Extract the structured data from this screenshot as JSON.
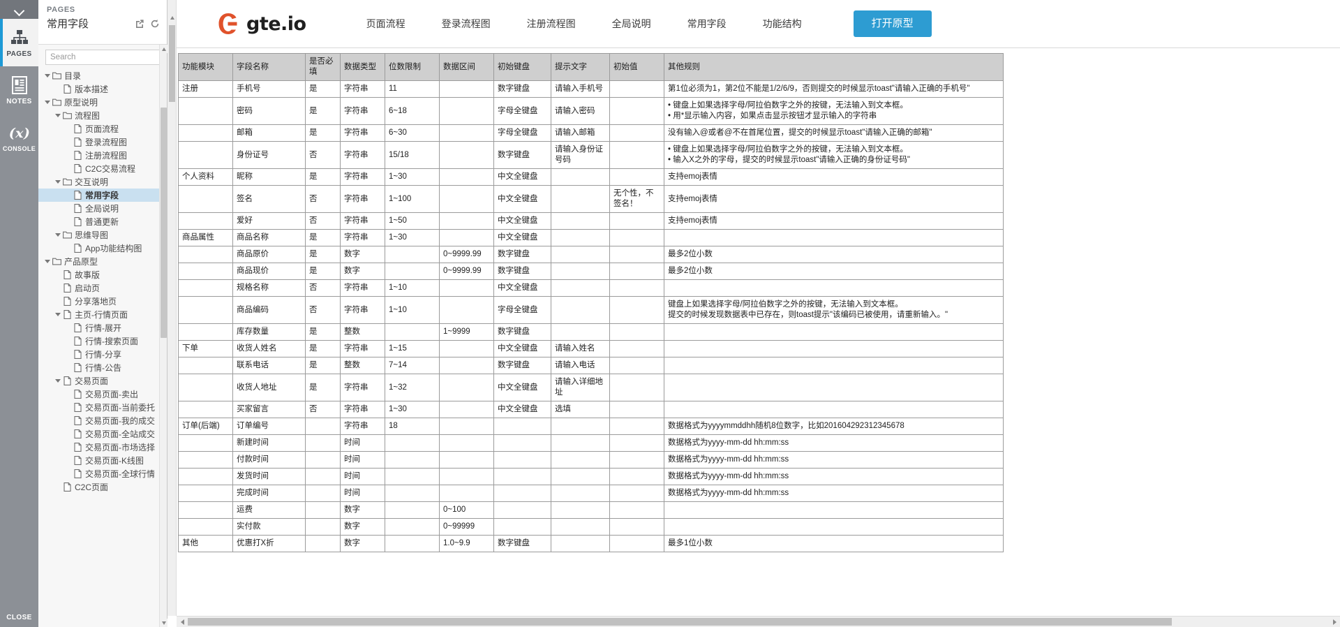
{
  "rail": {
    "collapse_icon": "chevron-down-icon",
    "buttons": [
      {
        "id": "pages",
        "label": "PAGES",
        "icon": "sitemap-icon",
        "active": true
      },
      {
        "id": "notes",
        "label": "NOTES",
        "icon": "notes-icon",
        "active": false
      },
      {
        "id": "console",
        "label": "CONSOLE",
        "icon": "variable-x-icon",
        "active": false
      }
    ],
    "close_label": "CLOSE"
  },
  "pages_panel": {
    "kicker": "PAGES",
    "title": "常用字段",
    "header_icons": [
      "open-in-new-icon",
      "refresh-icon"
    ],
    "search": {
      "placeholder": "Search",
      "value": ""
    },
    "tree": [
      {
        "label": "目录",
        "type": "folder",
        "depth": 0,
        "expanded": true,
        "selected": false
      },
      {
        "label": "版本描述",
        "type": "page",
        "depth": 1,
        "expanded": null,
        "selected": false
      },
      {
        "label": "原型说明",
        "type": "folder",
        "depth": 0,
        "expanded": true,
        "selected": false
      },
      {
        "label": "流程图",
        "type": "folder",
        "depth": 1,
        "expanded": true,
        "selected": false
      },
      {
        "label": "页面流程",
        "type": "page",
        "depth": 2,
        "expanded": null,
        "selected": false
      },
      {
        "label": "登录流程图",
        "type": "page",
        "depth": 2,
        "expanded": null,
        "selected": false
      },
      {
        "label": "注册流程图",
        "type": "page",
        "depth": 2,
        "expanded": null,
        "selected": false
      },
      {
        "label": "C2C交易流程",
        "type": "page",
        "depth": 2,
        "expanded": null,
        "selected": false
      },
      {
        "label": "交互说明",
        "type": "folder",
        "depth": 1,
        "expanded": true,
        "selected": false
      },
      {
        "label": "常用字段",
        "type": "page",
        "depth": 2,
        "expanded": null,
        "selected": true
      },
      {
        "label": "全局说明",
        "type": "page",
        "depth": 2,
        "expanded": null,
        "selected": false
      },
      {
        "label": "普通更新",
        "type": "page",
        "depth": 2,
        "expanded": null,
        "selected": false
      },
      {
        "label": "思维导图",
        "type": "folder",
        "depth": 1,
        "expanded": true,
        "selected": false
      },
      {
        "label": "App功能结构图",
        "type": "page",
        "depth": 2,
        "expanded": null,
        "selected": false
      },
      {
        "label": "产品原型",
        "type": "folder",
        "depth": 0,
        "expanded": true,
        "selected": false
      },
      {
        "label": "故事版",
        "type": "page",
        "depth": 1,
        "expanded": null,
        "selected": false
      },
      {
        "label": "启动页",
        "type": "page",
        "depth": 1,
        "expanded": null,
        "selected": false
      },
      {
        "label": "分享落地页",
        "type": "page",
        "depth": 1,
        "expanded": null,
        "selected": false
      },
      {
        "label": "主页-行情页面",
        "type": "page",
        "depth": 1,
        "expanded": true,
        "selected": false
      },
      {
        "label": "行情-展开",
        "type": "page",
        "depth": 2,
        "expanded": null,
        "selected": false
      },
      {
        "label": "行情-搜索页面",
        "type": "page",
        "depth": 2,
        "expanded": null,
        "selected": false
      },
      {
        "label": "行情-分享",
        "type": "page",
        "depth": 2,
        "expanded": null,
        "selected": false
      },
      {
        "label": "行情-公告",
        "type": "page",
        "depth": 2,
        "expanded": null,
        "selected": false
      },
      {
        "label": "交易页面",
        "type": "page",
        "depth": 1,
        "expanded": true,
        "selected": false
      },
      {
        "label": "交易页面-卖出",
        "type": "page",
        "depth": 2,
        "expanded": null,
        "selected": false
      },
      {
        "label": "交易页面-当前委托",
        "type": "page",
        "depth": 2,
        "expanded": null,
        "selected": false
      },
      {
        "label": "交易页面-我的成交",
        "type": "page",
        "depth": 2,
        "expanded": null,
        "selected": false
      },
      {
        "label": "交易页面-全站成交",
        "type": "page",
        "depth": 2,
        "expanded": null,
        "selected": false
      },
      {
        "label": "交易页面-市场选择",
        "type": "page",
        "depth": 2,
        "expanded": null,
        "selected": false
      },
      {
        "label": "交易页面-K线图",
        "type": "page",
        "depth": 2,
        "expanded": null,
        "selected": false
      },
      {
        "label": "交易页面-全球行情",
        "type": "page",
        "depth": 2,
        "expanded": null,
        "selected": false
      },
      {
        "label": "C2C页面",
        "type": "page",
        "depth": 1,
        "expanded": null,
        "selected": false
      }
    ]
  },
  "site_header": {
    "brand": "gte.io",
    "brand_icon": "gte-logo-icon",
    "nav": [
      {
        "label": "页面流程"
      },
      {
        "label": "登录流程图"
      },
      {
        "label": "注册流程图"
      },
      {
        "label": "全局说明"
      },
      {
        "label": "常用字段"
      },
      {
        "label": "功能结构"
      }
    ],
    "cta_label": "打开原型",
    "cta_color": "#2d9cd2"
  },
  "spec_table": {
    "columns": [
      "功能模块",
      "字段名称",
      "是否必填",
      "数据类型",
      "位数限制",
      "数据区间",
      "初始键盘",
      "提示文字",
      "初始值",
      "其他规则"
    ],
    "rows": [
      {
        "功能模块": "注册",
        "字段名称": "手机号",
        "是否必填": "是",
        "数据类型": "字符串",
        "位数限制": "11",
        "数据区间": "",
        "初始键盘": "数字键盘",
        "提示文字": "请输入手机号",
        "初始值": "",
        "其他规则": [
          "第1位必须为1，第2位不能是1/2/6/9，否则提交的时候显示toast\"请输入正确的手机号\""
        ]
      },
      {
        "功能模块": "",
        "字段名称": "密码",
        "是否必填": "是",
        "数据类型": "字符串",
        "位数限制": "6~18",
        "数据区间": "",
        "初始键盘": "字母全键盘",
        "提示文字": "请输入密码",
        "初始值": "",
        "其他规则": [
          "• 键盘上如果选择字母/阿拉伯数字之外的按键，无法输入到文本框。",
          "• 用*显示输入内容，如果点击显示按钮才显示输入的字符串"
        ]
      },
      {
        "功能模块": "",
        "字段名称": "邮箱",
        "是否必填": "是",
        "数据类型": "字符串",
        "位数限制": "6~30",
        "数据区间": "",
        "初始键盘": "字母全键盘",
        "提示文字": "请输入邮箱",
        "初始值": "",
        "其他规则": [
          "没有输入@或者@不在首尾位置，提交的时候显示toast\"请输入正确的邮箱\""
        ]
      },
      {
        "功能模块": "",
        "字段名称": "身份证号",
        "是否必填": "否",
        "数据类型": "字符串",
        "位数限制": "15/18",
        "数据区间": "",
        "初始键盘": "数字键盘",
        "提示文字": "请输入身份证号码",
        "初始值": "",
        "其他规则": [
          "• 键盘上如果选择字母/阿拉伯数字之外的按键，无法输入到文本框。",
          "• 输入X之外的字母，提交的时候显示toast\"请输入正确的身份证号码\""
        ]
      },
      {
        "功能模块": "个人资料",
        "字段名称": "昵称",
        "是否必填": "是",
        "数据类型": "字符串",
        "位数限制": "1~30",
        "数据区间": "",
        "初始键盘": "中文全键盘",
        "提示文字": "",
        "初始值": "",
        "其他规则": [
          "支持emoj表情"
        ]
      },
      {
        "功能模块": "",
        "字段名称": "签名",
        "是否必填": "否",
        "数据类型": "字符串",
        "位数限制": "1~100",
        "数据区间": "",
        "初始键盘": "中文全键盘",
        "提示文字": "",
        "初始值": "无个性，不签名！",
        "其他规则": [
          "支持emoj表情"
        ]
      },
      {
        "功能模块": "",
        "字段名称": "爱好",
        "是否必填": "否",
        "数据类型": "字符串",
        "位数限制": "1~50",
        "数据区间": "",
        "初始键盘": "中文全键盘",
        "提示文字": "",
        "初始值": "",
        "其他规则": [
          "支持emoj表情"
        ]
      },
      {
        "功能模块": "商品属性",
        "字段名称": "商品名称",
        "是否必填": "是",
        "数据类型": "字符串",
        "位数限制": "1~30",
        "数据区间": "",
        "初始键盘": "中文全键盘",
        "提示文字": "",
        "初始值": "",
        "其他规则": [
          ""
        ]
      },
      {
        "功能模块": "",
        "字段名称": "商品原价",
        "是否必填": "是",
        "数据类型": "数字",
        "位数限制": "",
        "数据区间": "0~9999.99",
        "初始键盘": "数字键盘",
        "提示文字": "",
        "初始值": "",
        "其他规则": [
          "最多2位小数"
        ]
      },
      {
        "功能模块": "",
        "字段名称": "商品现价",
        "是否必填": "是",
        "数据类型": "数字",
        "位数限制": "",
        "数据区间": "0~9999.99",
        "初始键盘": "数字键盘",
        "提示文字": "",
        "初始值": "",
        "其他规则": [
          "最多2位小数"
        ]
      },
      {
        "功能模块": "",
        "字段名称": "规格名称",
        "是否必填": "否",
        "数据类型": "字符串",
        "位数限制": "1~10",
        "数据区间": "",
        "初始键盘": "中文全键盘",
        "提示文字": "",
        "初始值": "",
        "其他规则": [
          ""
        ]
      },
      {
        "功能模块": "",
        "字段名称": "商品编码",
        "是否必填": "否",
        "数据类型": "字符串",
        "位数限制": "1~10",
        "数据区间": "",
        "初始键盘": "字母全键盘",
        "提示文字": "",
        "初始值": "",
        "其他规则": [
          "键盘上如果选择字母/阿拉伯数字之外的按键，无法输入到文本框。",
          "提交的时候发现数据表中已存在，则toast提示\"该编码已被使用，请重新输入。\""
        ]
      },
      {
        "功能模块": "",
        "字段名称": "库存数量",
        "是否必填": "是",
        "数据类型": "整数",
        "位数限制": "",
        "数据区间": "1~9999",
        "初始键盘": "数字键盘",
        "提示文字": "",
        "初始值": "",
        "其他规则": [
          ""
        ]
      },
      {
        "功能模块": "下单",
        "字段名称": "收货人姓名",
        "是否必填": "是",
        "数据类型": "字符串",
        "位数限制": "1~15",
        "数据区间": "",
        "初始键盘": "中文全键盘",
        "提示文字": "请输入姓名",
        "初始值": "",
        "其他规则": [
          ""
        ]
      },
      {
        "功能模块": "",
        "字段名称": "联系电话",
        "是否必填": "是",
        "数据类型": "整数",
        "位数限制": "7~14",
        "数据区间": "",
        "初始键盘": "数字键盘",
        "提示文字": "请输入电话",
        "初始值": "",
        "其他规则": [
          ""
        ]
      },
      {
        "功能模块": "",
        "字段名称": "收货人地址",
        "是否必填": "是",
        "数据类型": "字符串",
        "位数限制": "1~32",
        "数据区间": "",
        "初始键盘": "中文全键盘",
        "提示文字": "请输入详细地址",
        "初始值": "",
        "其他规则": [
          ""
        ]
      },
      {
        "功能模块": "",
        "字段名称": "买家留言",
        "是否必填": "否",
        "数据类型": "字符串",
        "位数限制": "1~30",
        "数据区间": "",
        "初始键盘": "中文全键盘",
        "提示文字": "选填",
        "初始值": "",
        "其他规则": [
          ""
        ]
      },
      {
        "功能模块": "订单(后端)",
        "字段名称": "订单编号",
        "是否必填": "",
        "数据类型": "字符串",
        "位数限制": "18",
        "数据区间": "",
        "初始键盘": "",
        "提示文字": "",
        "初始值": "",
        "其他规则": [
          "数据格式为yyyymmddhh随机8位数字，比如201604292312345678"
        ]
      },
      {
        "功能模块": "",
        "字段名称": "新建时间",
        "是否必填": "",
        "数据类型": "时间",
        "位数限制": "",
        "数据区间": "",
        "初始键盘": "",
        "提示文字": "",
        "初始值": "",
        "其他规则": [
          "数据格式为yyyy-mm-dd hh:mm:ss"
        ]
      },
      {
        "功能模块": "",
        "字段名称": "付款时间",
        "是否必填": "",
        "数据类型": "时间",
        "位数限制": "",
        "数据区间": "",
        "初始键盘": "",
        "提示文字": "",
        "初始值": "",
        "其他规则": [
          "数据格式为yyyy-mm-dd hh:mm:ss"
        ]
      },
      {
        "功能模块": "",
        "字段名称": "发货时间",
        "是否必填": "",
        "数据类型": "时间",
        "位数限制": "",
        "数据区间": "",
        "初始键盘": "",
        "提示文字": "",
        "初始值": "",
        "其他规则": [
          "数据格式为yyyy-mm-dd hh:mm:ss"
        ]
      },
      {
        "功能模块": "",
        "字段名称": "完成时间",
        "是否必填": "",
        "数据类型": "时间",
        "位数限制": "",
        "数据区间": "",
        "初始键盘": "",
        "提示文字": "",
        "初始值": "",
        "其他规则": [
          "数据格式为yyyy-mm-dd hh:mm:ss"
        ]
      },
      {
        "功能模块": "",
        "字段名称": "运费",
        "是否必填": "",
        "数据类型": "数字",
        "位数限制": "",
        "数据区间": "0~100",
        "初始键盘": "",
        "提示文字": "",
        "初始值": "",
        "其他规则": [
          ""
        ]
      },
      {
        "功能模块": "",
        "字段名称": "实付款",
        "是否必填": "",
        "数据类型": "数字",
        "位数限制": "",
        "数据区间": "0~99999",
        "初始键盘": "",
        "提示文字": "",
        "初始值": "",
        "其他规则": [
          ""
        ]
      },
      {
        "功能模块": "其他",
        "字段名称": "优惠打X折",
        "是否必填": "",
        "数据类型": "数字",
        "位数限制": "",
        "数据区间": "1.0~9.9",
        "初始键盘": "数字键盘",
        "提示文字": "",
        "初始值": "",
        "其他规则": [
          "最多1位小数"
        ]
      }
    ]
  }
}
